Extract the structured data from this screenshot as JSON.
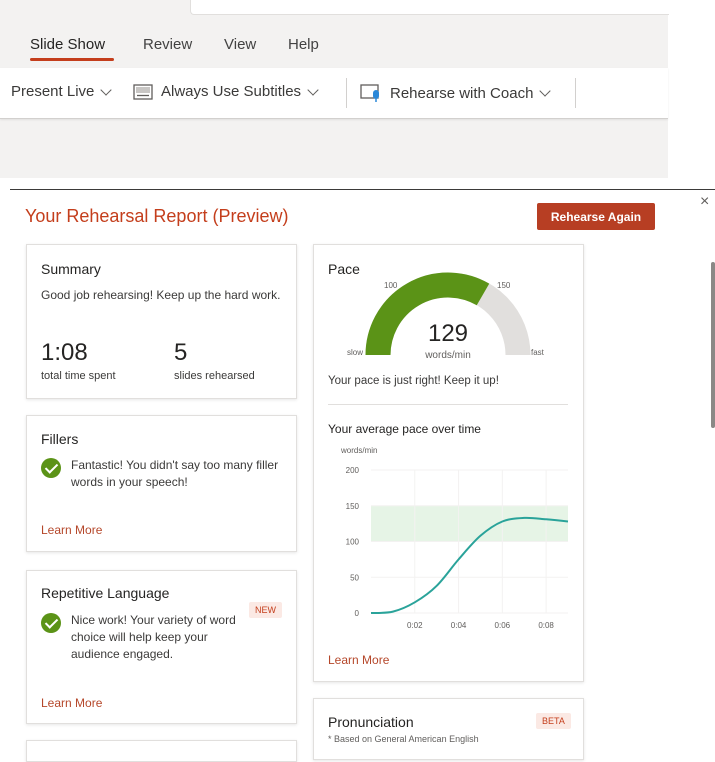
{
  "ribbon": {
    "tabs": [
      {
        "label": "Slide Show",
        "active": true
      },
      {
        "label": "Review",
        "active": false
      },
      {
        "label": "View",
        "active": false
      },
      {
        "label": "Help",
        "active": false
      }
    ],
    "toolbar": {
      "present_live": "Present Live",
      "subtitles": "Always Use Subtitles",
      "rehearse_coach": "Rehearse with Coach"
    }
  },
  "report": {
    "title": "Your Rehearsal Report (Preview)",
    "rehearse_again": "Rehearse Again",
    "close_glyph": "×",
    "summary": {
      "title": "Summary",
      "message": "Good job rehearsing! Keep up the hard work.",
      "time_value": "1:08",
      "time_label": "total time spent",
      "slides_value": "5",
      "slides_label": "slides rehearsed"
    },
    "fillers": {
      "title": "Fillers",
      "message": "Fantastic! You didn't say too many filler words in your speech!",
      "link": "Learn More"
    },
    "repetitive": {
      "title": "Repetitive Language",
      "badge": "NEW",
      "message": "Nice work! Your variety of word choice will help keep your audience engaged.",
      "link": "Learn More"
    },
    "pace": {
      "title": "Pace",
      "gauge": {
        "value": 129,
        "unit": "words/min",
        "min": 50,
        "max": 200,
        "zone_low": 100,
        "zone_high": 150,
        "label_100": "100",
        "label_150": "150",
        "label_slow": "slow",
        "label_fast": "fast"
      },
      "message": "Your pace is just right! Keep it up!",
      "chart_title": "Your average pace over time",
      "link": "Learn More"
    },
    "pronunciation": {
      "title": "Pronunciation",
      "badge": "BETA",
      "note": "* Based on General American English"
    }
  },
  "colors": {
    "accent": "#c43e1c",
    "button": "#b73e23",
    "gauge_fill": "#5b9317",
    "gauge_track": "#e1dfdd",
    "pace_line": "#2aa39a",
    "target_band": "#e6f4e6"
  },
  "chart_data": {
    "type": "line",
    "title": "Your average pace over time",
    "ylabel": "words/min",
    "xlabel": "",
    "ylim": [
      0,
      200
    ],
    "yticks": [
      "0",
      "50",
      "100",
      "150",
      "200"
    ],
    "xticks": [
      "0:02",
      "0:04",
      "0:06",
      "0:08"
    ],
    "xtick_values": [
      2,
      4,
      6,
      8
    ],
    "xlim": [
      0,
      9
    ],
    "band": [
      100,
      150
    ],
    "series": [
      {
        "x": [
          0,
          1,
          2,
          3,
          4,
          5,
          6,
          7,
          8,
          9
        ],
        "values": [
          0,
          2,
          15,
          38,
          75,
          108,
          128,
          133,
          131,
          128
        ]
      }
    ]
  }
}
